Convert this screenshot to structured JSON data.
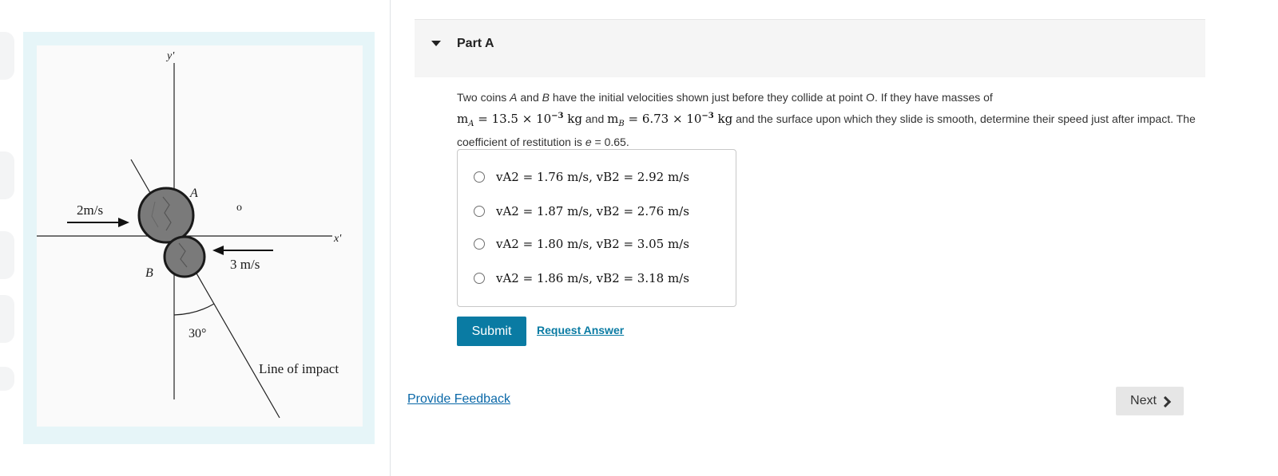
{
  "figure": {
    "y_axis_label": "y'",
    "x_axis_label": "x'",
    "coin_a_label": "A",
    "coin_b_label": "B",
    "point_label": "o",
    "velocity_a": "2m/s",
    "velocity_b": "3 m/s",
    "angle": "30°",
    "line_label": "Line of impact"
  },
  "part": {
    "title": "Part A",
    "question": {
      "intro": "Two coins ",
      "coin_a": "A",
      "and": " and ",
      "coin_b": "B",
      "text1": " have the initial velocities shown just before they collide at point O. If they have masses of",
      "ma_sym": "m",
      "ma_sub": "A",
      "ma_val": " = 13.5 × 10",
      "ma_exp": "−3",
      "unit_kg": " kg",
      "text2": " and ",
      "mb_sym": "m",
      "mb_sub": "B",
      "mb_val": " = 6.73 × 10",
      "mb_exp": "−3",
      "text3": " and the surface upon which they slide is smooth, determine their speed just after impact. The coefficient of restitution is ",
      "e_sym": "e",
      "e_val": " = 0.65."
    },
    "options": [
      "vA2 = 1.76 m/s,  vB2 = 2.92 m/s",
      "vA2 = 1.87 m/s,  vB2 = 2.76 m/s",
      "vA2 = 1.80 m/s,  vB2 = 3.05 m/s",
      "vA2 = 1.86 m/s,  vB2 = 3.18 m/s"
    ],
    "submit_label": "Submit",
    "request_answer_label": "Request Answer"
  },
  "footer": {
    "feedback_label": "Provide Feedback",
    "next_label": "Next"
  }
}
